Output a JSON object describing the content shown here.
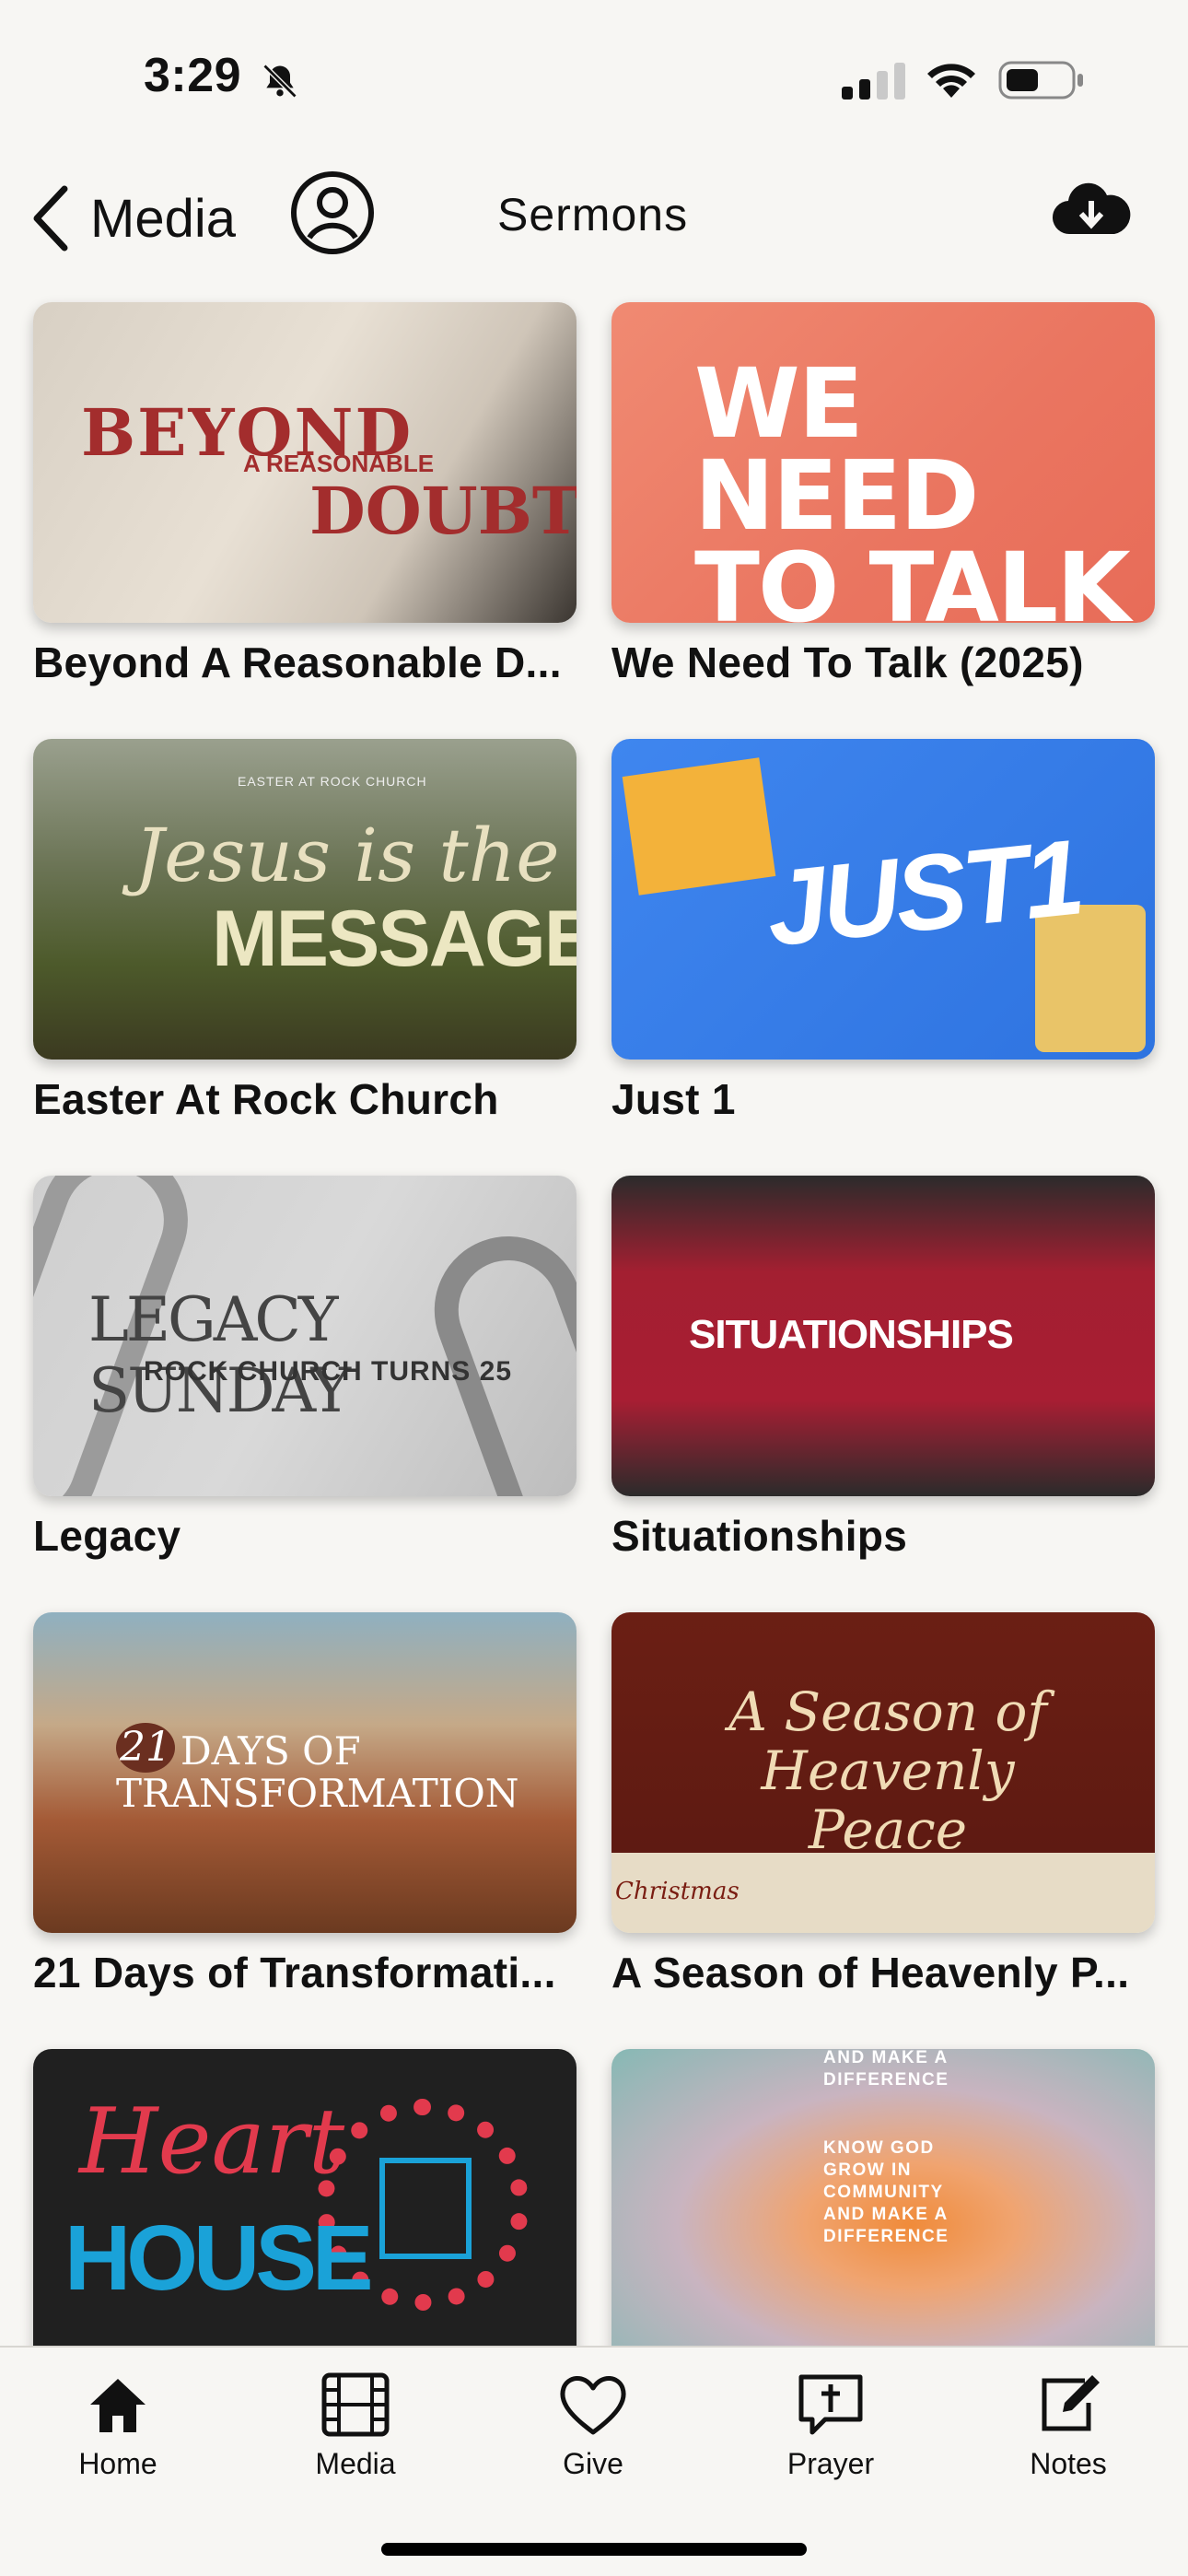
{
  "status_bar": {
    "time": "3:29",
    "icons": [
      "bell-slash-icon",
      "signal-icon",
      "wifi-icon",
      "battery-icon"
    ]
  },
  "header": {
    "back_label": "Media",
    "title": "Sermons",
    "icons": [
      "chevron-left-icon",
      "profile-icon",
      "cloud-download-icon"
    ]
  },
  "sermons": [
    {
      "title": "Beyond A Reasonable D...",
      "art": {
        "lines": [
          "BEYOND",
          "A REASONABLE",
          "DOUBT"
        ]
      }
    },
    {
      "title": "We Need To Talk (2025)",
      "art": {
        "lines": [
          "WE NEED",
          "TO TALK"
        ]
      }
    },
    {
      "title": "Easter At Rock Church",
      "art": {
        "lines": [
          "EASTER AT ROCK CHURCH",
          "Jesus is the",
          "MESSAGE"
        ]
      }
    },
    {
      "title": "Just 1",
      "art": {
        "lines": [
          "JUST1"
        ]
      }
    },
    {
      "title": "Legacy",
      "art": {
        "lines": [
          "LEGACY SUNDAY",
          "ROCK CHURCH TURNS 25"
        ]
      }
    },
    {
      "title": "Situationships",
      "art": {
        "lines": [
          "SITUATIONSHIPS"
        ]
      }
    },
    {
      "title": "21 Days of Transformati...",
      "art": {
        "lines": [
          "21",
          "DAYS OF",
          "TRANSFORMATION"
        ]
      }
    },
    {
      "title": "A Season of Heavenly P...",
      "art": {
        "lines": [
          "A Season of Heavenly Peace",
          "Christmas"
        ]
      }
    },
    {
      "title": "",
      "art": {
        "lines": [
          "Heart",
          "HOUSE"
        ]
      }
    },
    {
      "title": "",
      "art": {
        "lines": [
          "AND MAKE A DIFFERENCE",
          "KNOW GOD GROW IN COMMUNITY AND MAKE A DIFFERENCE"
        ]
      }
    }
  ],
  "tab_bar": {
    "tabs": [
      {
        "label": "Home",
        "icon": "home-icon"
      },
      {
        "label": "Media",
        "icon": "film-icon"
      },
      {
        "label": "Give",
        "icon": "heart-icon"
      },
      {
        "label": "Prayer",
        "icon": "prayer-icon"
      },
      {
        "label": "Notes",
        "icon": "notes-icon"
      }
    ]
  },
  "colors": {
    "background": "#f7f6f3",
    "text": "#111111"
  }
}
